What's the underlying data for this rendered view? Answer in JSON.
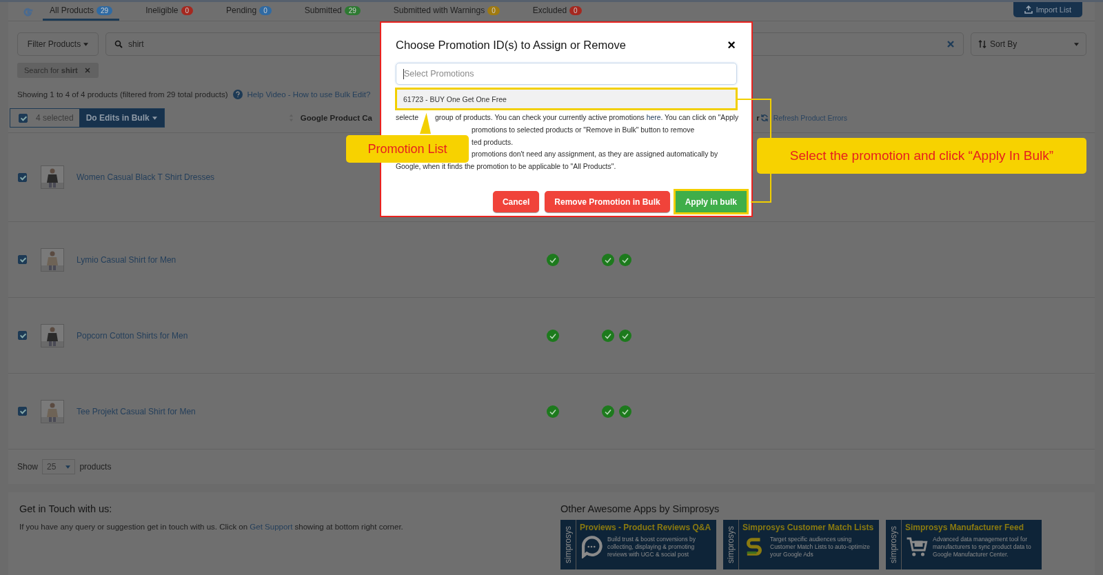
{
  "tabs": [
    {
      "label": "All Products",
      "count": "29",
      "color": "#2f6aa3",
      "selected": true
    },
    {
      "label": "Ineligible",
      "count": "0",
      "color": "#a5281f",
      "selected": false
    },
    {
      "label": "Pending",
      "count": "0",
      "color": "#2f6aa3",
      "selected": false
    },
    {
      "label": "Submitted",
      "count": "29",
      "color": "#2e7a32",
      "selected": false
    },
    {
      "label": "Submitted with Warnings",
      "count": "0",
      "color": "#a07a10",
      "selected": false
    },
    {
      "label": "Excluded",
      "count": "0",
      "color": "#a5281f",
      "selected": false
    }
  ],
  "import_button": "Import List",
  "filter_button": "Filter Products",
  "search": {
    "value": "shirt"
  },
  "sort": {
    "placeholder": "Sort By"
  },
  "chip": "Search for **shirt**",
  "showing": "Showing 1 to 4 of 4 products (filtered from 29 total products)",
  "help_link": "Help Video - How to use Bulk Edit?",
  "bulk": {
    "checked": true,
    "selected_label": "4 selected",
    "action": "Do Edits in Bulk"
  },
  "columns": [
    {
      "label": "Google Product Ca"
    },
    {
      "label": "r"
    }
  ],
  "refresh": "Refresh Product Errors",
  "products": [
    {
      "name": "Women Casual Black T Shirt Dresses",
      "checked": true
    },
    {
      "name": "Lymio Casual Shirt for Men",
      "checked": true,
      "checks": [
        true,
        true,
        true
      ]
    },
    {
      "name": "Popcorn Cotton Shirts for Men",
      "checked": true,
      "checks": [
        true,
        true,
        true
      ]
    },
    {
      "name": "Tee Projekt Casual Shirt for Men",
      "checked": true,
      "checks": [
        true,
        true,
        true
      ]
    }
  ],
  "pager": {
    "label": "Show",
    "value": "25",
    "suffix": "products"
  },
  "contact": {
    "title": "Get in Touch with us:",
    "before": "If you have any query or suggestion get in touch with us. Click on",
    "link": "Get Support",
    "after": "showing at bottom right corner."
  },
  "apps_title": "Other Awesome Apps by Simprosys",
  "apps": [
    {
      "kind": "reviews",
      "brand": "simprosys",
      "title": "Proviews - Product Reviews Q&A",
      "desc": "Build trust & boost conversions by collecting, displaying & promoting reviews with UGC & social post"
    },
    {
      "kind": "match",
      "brand": "simprosys",
      "title": "Simprosys Customer Match Lists",
      "desc": "Target specific audiences using Customer Match Lists to auto-optimize your Google Ads"
    },
    {
      "kind": "cart",
      "brand": "simprosys",
      "title": "Simprosys Manufacturer Feed",
      "desc": "Advanced data management tool for manufacturers to sync product data to Google Manufacturer Center."
    }
  ],
  "modal": {
    "title": "Choose Promotion ID(s) to Assign or Remove",
    "close": "×",
    "placeholder": "Select Promotions",
    "option": "61723 - BUY One Get One Free",
    "line_1_start": "selecte",
    "line_1": "group of products. You can check your currently active promotions",
    "link": "here",
    "line_1_end": ". You can click on \"Apply",
    "line_2": "promotions to selected products or \"Remove in Bulk\" button to remove",
    "line_3": "ted products.",
    "line_4": "promotions don't need any assignment, as they are assigned automatically by",
    "line_5": "Google, when it finds the promotion to be applicable to \"All Products\".",
    "buttons": [
      {
        "label": "Cancel",
        "kind": "cancel"
      },
      {
        "label": "Remove Promotion in Bulk",
        "kind": "remove"
      },
      {
        "label": "Apply in bulk",
        "kind": "apply"
      }
    ]
  },
  "annotations": [
    {
      "text": "Promotion List",
      "kind": "left"
    },
    {
      "text": "Select the promotion and click “Apply In Bulk”",
      "kind": "right"
    }
  ]
}
